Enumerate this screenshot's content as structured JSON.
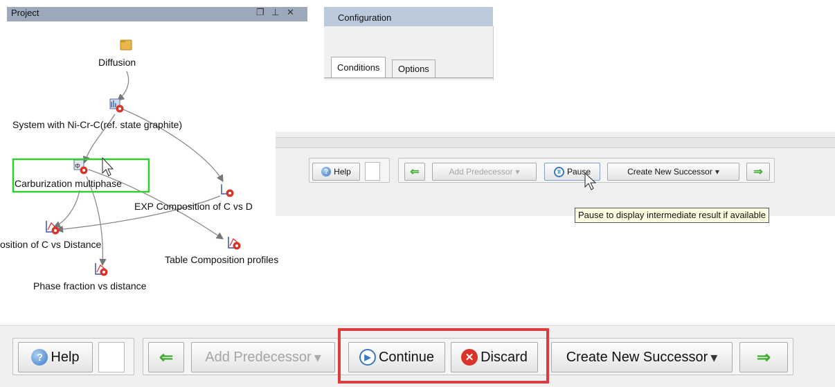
{
  "project_panel": {
    "title": "Project",
    "header_icons": [
      "restore-icon",
      "pin-icon",
      "close-icon"
    ],
    "nodes": {
      "diffusion": "Diffusion",
      "system": "System with Ni-Cr-C(ref. state graphite)",
      "carburization": "Carburization multiphase",
      "exp_composition": "EXP Composition of C vs D",
      "composition_distance": "osition of C vs Distance",
      "table_profiles": "Table Composition profiles",
      "phase_fraction": "Phase fraction vs distance"
    },
    "selected_node": "Carburization multiphase",
    "colors": {
      "selection": "#33cc33",
      "header": "#9ba9bb",
      "node_badge": "#d9342a"
    }
  },
  "configuration_panel": {
    "title": "Configuration",
    "tabs": [
      "Conditions",
      "Options"
    ],
    "active_tab": "Conditions"
  },
  "toolbar_running": {
    "help": "Help",
    "add_predecessor": "Add Predecessor",
    "pause": "Pause",
    "create_successor": "Create New Successor",
    "tooltip": "Pause to display intermediate result if available"
  },
  "toolbar_paused": {
    "help": "Help",
    "add_predecessor": "Add Predecessor",
    "continue": "Continue",
    "discard": "Discard",
    "create_successor": "Create New Successor",
    "highlight_color": "#dc3c3c"
  }
}
